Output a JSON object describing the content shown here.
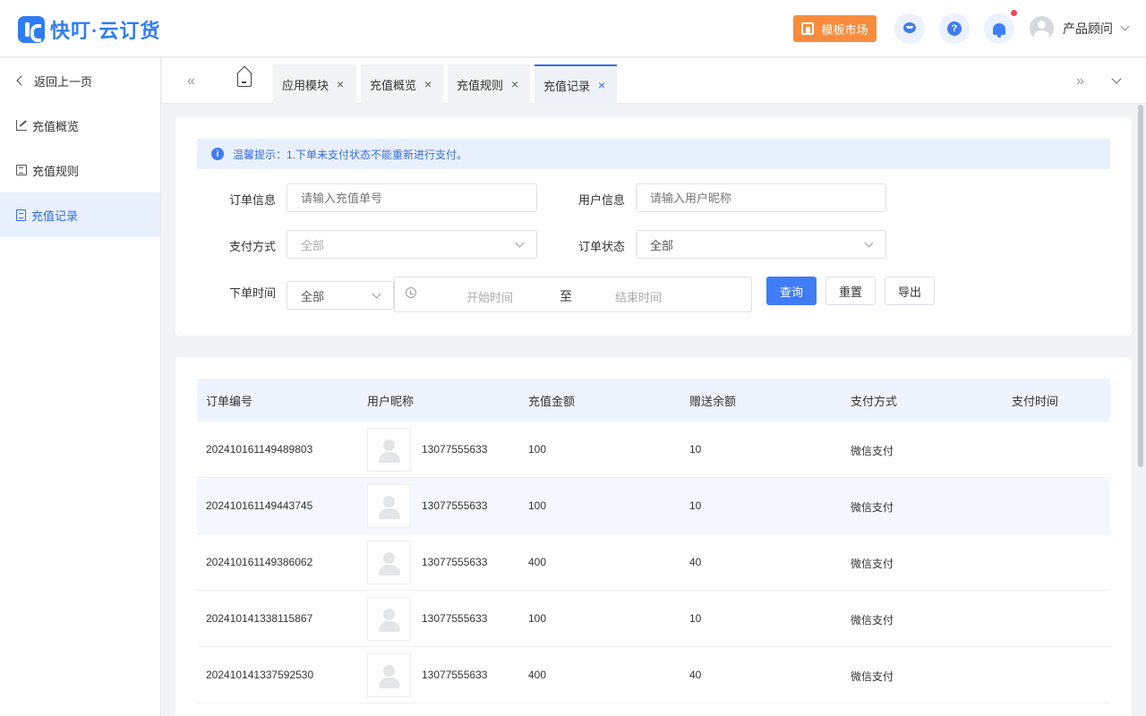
{
  "header": {
    "logo_text": "快叮·云订货",
    "market_label": "模板市场",
    "user_name": "产品顾问",
    "accent": "#3f7cf5",
    "market_color": "#f98c3c"
  },
  "sidebar": {
    "back_label": "返回上一页",
    "items": [
      {
        "label": "充值概览",
        "icon": "trend-icon"
      },
      {
        "label": "充值规则",
        "icon": "list-icon"
      },
      {
        "label": "充值记录",
        "icon": "document-icon",
        "active": true
      }
    ]
  },
  "tabs": [
    {
      "label": "应用模块",
      "close": "×"
    },
    {
      "label": "充值概览",
      "close": "×"
    },
    {
      "label": "充值规则",
      "close": "×"
    },
    {
      "label": "充值记录",
      "close": "×",
      "active": true
    }
  ],
  "tab_nav": {
    "prev": "«",
    "next": "»"
  },
  "filters": {
    "tip": "温馨提示：1.下单未支付状态不能重新进行支付。",
    "order_info_label": "订单信息",
    "order_info_placeholder": "请输入充值单号",
    "user_info_label": "用户信息",
    "user_info_placeholder": "请输入用户昵称",
    "pay_method_label": "支付方式",
    "pay_method_value": "全部",
    "order_status_label": "订单状态",
    "order_status_value": "全部",
    "time_label": "下单时间",
    "time_range_value": "全部",
    "start_placeholder": "开始时间",
    "range_sep": "至",
    "end_placeholder": "结束时间",
    "query_label": "查询",
    "reset_label": "重置",
    "export_label": "导出"
  },
  "table": {
    "columns": [
      "订单编号",
      "用户昵称",
      "充值金额",
      "赠送余额",
      "支付方式",
      "支付时间"
    ],
    "rows": [
      {
        "order": "202410161149489803",
        "user": "13077555633",
        "amount": "100",
        "bonus": "10",
        "method": "微信支付",
        "time": ""
      },
      {
        "order": "202410161149443745",
        "user": "13077555633",
        "amount": "100",
        "bonus": "10",
        "method": "微信支付",
        "time": ""
      },
      {
        "order": "202410161149386062",
        "user": "13077555633",
        "amount": "400",
        "bonus": "40",
        "method": "微信支付",
        "time": ""
      },
      {
        "order": "202410141338115867",
        "user": "13077555633",
        "amount": "100",
        "bonus": "10",
        "method": "微信支付",
        "time": ""
      },
      {
        "order": "202410141337592530",
        "user": "13077555633",
        "amount": "400",
        "bonus": "40",
        "method": "微信支付",
        "time": ""
      }
    ]
  }
}
